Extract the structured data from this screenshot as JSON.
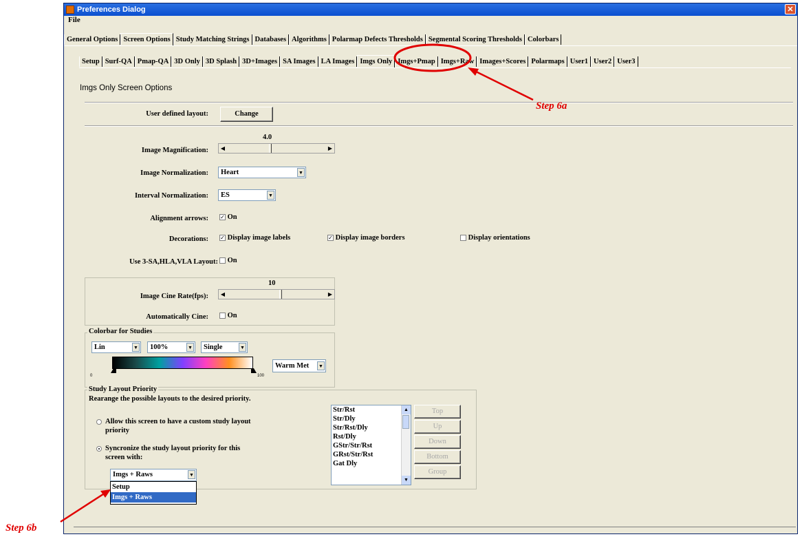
{
  "window": {
    "title": "Preferences Dialog",
    "close_glyph": "✕"
  },
  "menu": {
    "file": "File"
  },
  "main_tabs": [
    "General Options",
    "Screen Options",
    "Study Matching Strings",
    "Databases",
    "Algorithms",
    "Polarmap Defects Thresholds",
    "Segmental Scoring Thresholds",
    "Colorbars"
  ],
  "main_tab_active": "Screen Options",
  "sub_tabs": [
    "Setup",
    "Surf-QA",
    "Pmap-QA",
    "3D Only",
    "3D Splash",
    "3D+Images",
    "SA Images",
    "LA Images",
    "Imgs Only",
    "Imgs+Pmap",
    "Imgs+Raw",
    "Images+Scores",
    "Polarmaps",
    "User1",
    "User2",
    "User3"
  ],
  "sub_tab_active": "Imgs Only",
  "section_title": "Imgs Only Screen Options",
  "layout": {
    "label": "User defined layout:",
    "button": "Change"
  },
  "magnification": {
    "label": "Image Magnification:",
    "value_text": "4.0",
    "position": 0.42
  },
  "normalization": {
    "label": "Image Normalization:",
    "value": "Heart"
  },
  "interval": {
    "label": "Interval Normalization:",
    "value": "ES"
  },
  "alignment": {
    "label": "Alignment arrows:",
    "checked": true,
    "text": "On"
  },
  "decorations": {
    "label": "Decorations:",
    "items": [
      {
        "text": "Display image labels",
        "checked": true
      },
      {
        "text": "Display image borders",
        "checked": true
      },
      {
        "text": "Display orientations",
        "checked": false
      }
    ]
  },
  "use3": {
    "label": "Use 3-SA,HLA,VLA Layout:",
    "checked": false,
    "text": "On"
  },
  "cine": {
    "label": "Image Cine Rate(fps):",
    "value_text": "10",
    "position": 0.52
  },
  "auto_cine": {
    "label": "Automatically Cine:",
    "checked": false,
    "text": "On"
  },
  "colorbar": {
    "title": "Colorbar for Studies",
    "scale": "Lin",
    "percent": "100%",
    "mode": "Single",
    "min_label": "0",
    "max_label": "100",
    "palette": "Warm Met",
    "gradient_colors": [
      "#000000",
      "#1a4a4a",
      "#00a0a0",
      "#8040ff",
      "#ff40c0",
      "#ff9020",
      "#ffffff"
    ]
  },
  "priority": {
    "title": "Study Layout Priority",
    "subtitle": "Rearange the possible layouts to the desired priority.",
    "option_custom": "Allow this screen to have a custom study layout priority",
    "option_sync": "Syncronize the study layout priority  for this screen with:",
    "selected": "sync",
    "sync_value": "Imgs + Raws",
    "dropdown_options": [
      "Setup",
      "Imgs + Raws"
    ],
    "dropdown_highlight": "Imgs + Raws",
    "list": [
      "Str/Rst",
      "Str/Dly",
      "Str/Rst/Dly",
      "Rst/Dly",
      "GStr/Str/Rst",
      "GRst/Str/Rst",
      "Gat Dly"
    ],
    "buttons": [
      "Top",
      "Up",
      "Down",
      "Bottom",
      "Group"
    ]
  },
  "annotations": {
    "step_a": "Step 6a",
    "step_b": "Step 6b",
    "color": "#e00000"
  }
}
